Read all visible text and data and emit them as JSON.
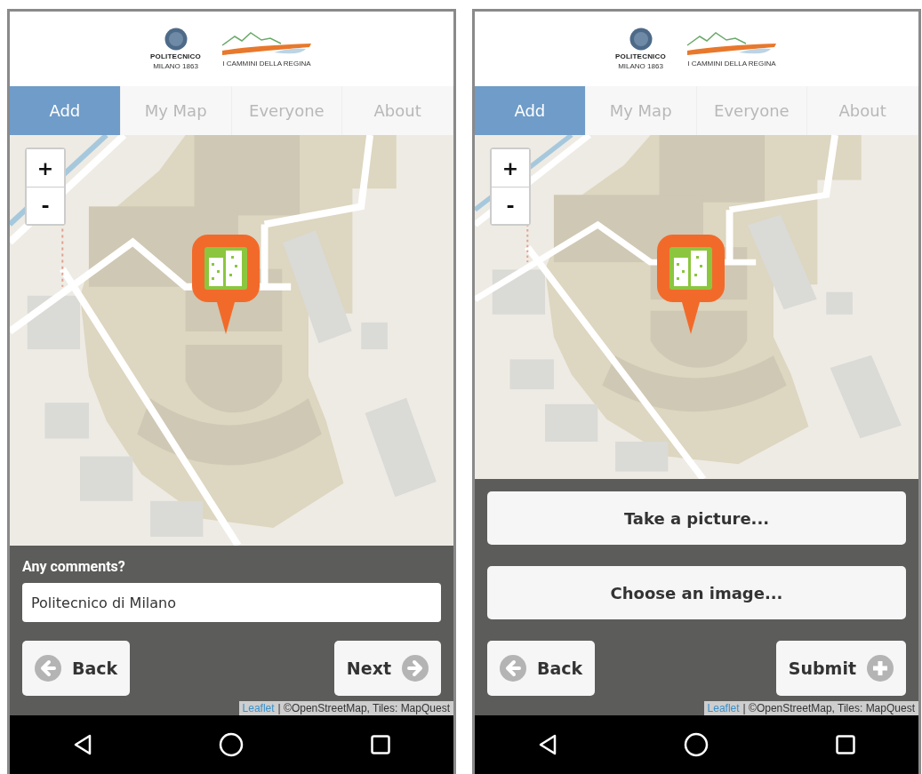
{
  "screens": [
    {
      "logos": [
        {
          "kind": "university",
          "name": "POLITECNICO",
          "subtitle": "MILANO 1863"
        },
        {
          "kind": "mountains",
          "name": "I CAMMINI DELLA REGINA"
        }
      ],
      "tabs": [
        {
          "label": "Add",
          "selected": true
        },
        {
          "label": "My Map",
          "selected": false
        },
        {
          "label": "Everyone",
          "selected": false
        },
        {
          "label": "About",
          "selected": false
        }
      ],
      "zoom_controls": [
        "+",
        "-"
      ],
      "panel": {
        "kind": "comment",
        "label": "Any comments?",
        "value": "Politecnico di Milano"
      },
      "back_button": "Back",
      "forward_button": {
        "kind": "next",
        "label": "Next"
      },
      "attribution": {
        "link": "Leaflet",
        "text": "| ©OpenStreetMap, Tiles: MapQuest"
      }
    },
    {
      "logos": [
        {
          "kind": "university",
          "name": "POLITECNICO",
          "subtitle": "MILANO 1863"
        },
        {
          "kind": "mountains",
          "name": "I CAMMINI DELLA REGINA"
        }
      ],
      "tabs": [
        {
          "label": "Add",
          "selected": true
        },
        {
          "label": "My Map",
          "selected": false
        },
        {
          "label": "Everyone",
          "selected": false
        },
        {
          "label": "About",
          "selected": false
        }
      ],
      "zoom_controls": [
        "+",
        "-"
      ],
      "panel": {
        "kind": "photo",
        "buttons": [
          "Take a picture...",
          "Choose an image..."
        ]
      },
      "back_button": "Back",
      "forward_button": {
        "kind": "submit",
        "label": "Submit"
      },
      "attribution": {
        "link": "Leaflet",
        "text": "| ©OpenStreetMap, Tiles: MapQuest"
      }
    }
  ]
}
